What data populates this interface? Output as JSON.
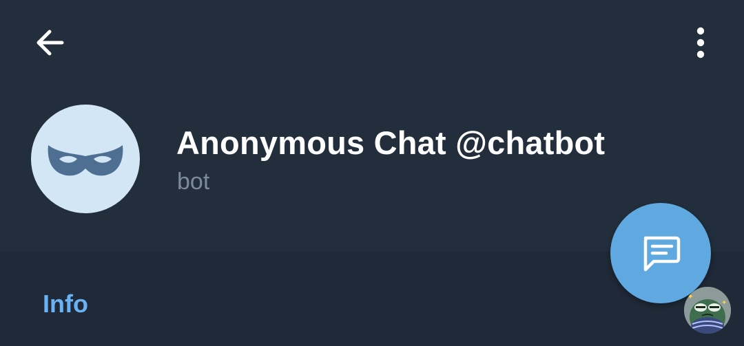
{
  "header": {
    "back_icon": "arrow-left-icon",
    "menu_icon": "more-vertical-icon"
  },
  "profile": {
    "avatar_icon": "mask-icon",
    "name": "Anonymous Chat @chatbot",
    "status": "bot"
  },
  "fab": {
    "icon": "message-icon"
  },
  "section": {
    "title": "Info"
  },
  "floating_sticker": {
    "icon": "frog-sticker-icon"
  },
  "colors": {
    "header_bg": "#232e3c",
    "section_bg": "#1f2937",
    "avatar_bg": "#d2e6f6",
    "mask": "#4e6f92",
    "fab_bg": "#5fa8e0",
    "accent_link": "#6ab2f2",
    "status_text": "#7d8b99"
  }
}
